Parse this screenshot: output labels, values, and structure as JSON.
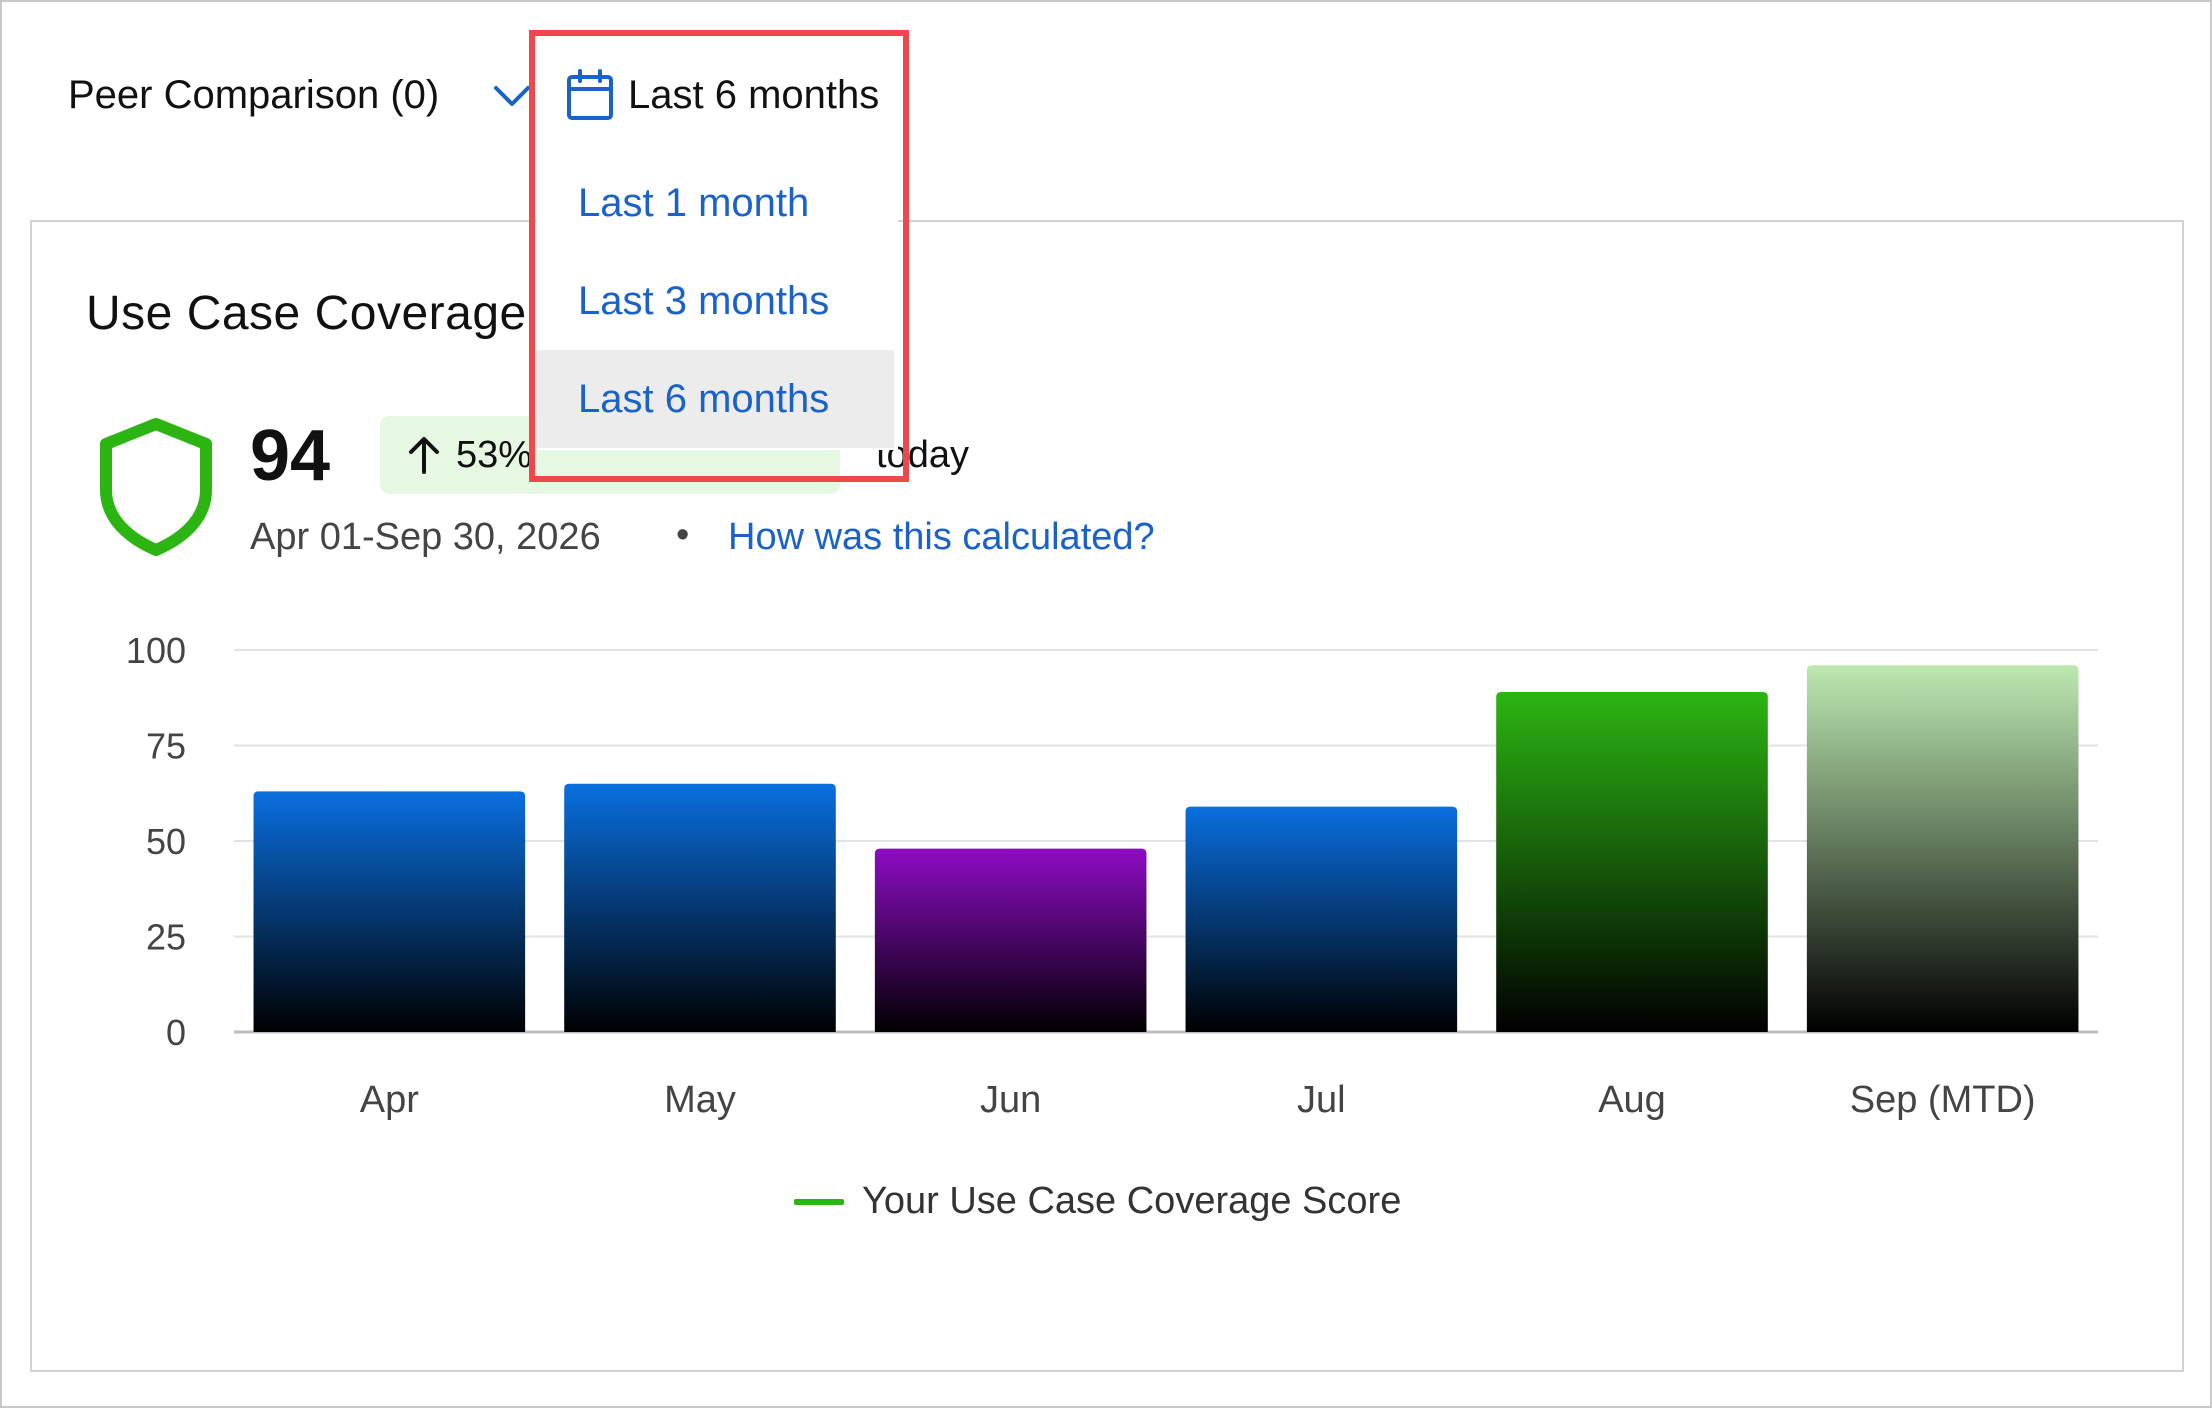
{
  "header": {
    "peer_comparison_label": "Peer Comparison (0)",
    "date_filter": {
      "selected_label": "Last 6 months",
      "options": [
        {
          "label": "Last 1 month",
          "selected": false
        },
        {
          "label": "Last 3 months",
          "selected": false
        },
        {
          "label": "Last 6 months",
          "selected": true
        }
      ]
    }
  },
  "card": {
    "title": "Use Case Coverage",
    "score": "94",
    "trend_percent": "53%",
    "trend_suffix": "today",
    "date_range": "Apr 01-Sep 30, 2026",
    "separator": "•",
    "calc_link": "How was this calculated?"
  },
  "colors": {
    "accent_blue": "#1a62c7",
    "score_green": "#2cb512",
    "highlight_red": "#f0474a",
    "bar_blue": "#0a6fe0",
    "bar_purple": "#8d0cc4",
    "bar_green": "#2cb512",
    "bar_light_green": "#bde9b1"
  },
  "icons": {
    "chevron": "chevron-down-icon",
    "calendar": "calendar-icon",
    "shield": "shield-icon",
    "trend": "arrow-up-icon"
  },
  "chart_data": {
    "type": "bar",
    "categories": [
      "Apr",
      "May",
      "Jun",
      "Jul",
      "Aug",
      "Sep (MTD)"
    ],
    "values": [
      63,
      65,
      48,
      59,
      89,
      96
    ],
    "bar_colors": [
      "blue",
      "blue",
      "purple",
      "blue",
      "green",
      "light-green"
    ],
    "ylim": [
      0,
      100
    ],
    "yticks": [
      0,
      25,
      50,
      75,
      100
    ],
    "grid": true,
    "legend": [
      {
        "label": "Your Use Case Coverage Score",
        "color": "#2cb512"
      }
    ],
    "legend_position": "bottom"
  }
}
